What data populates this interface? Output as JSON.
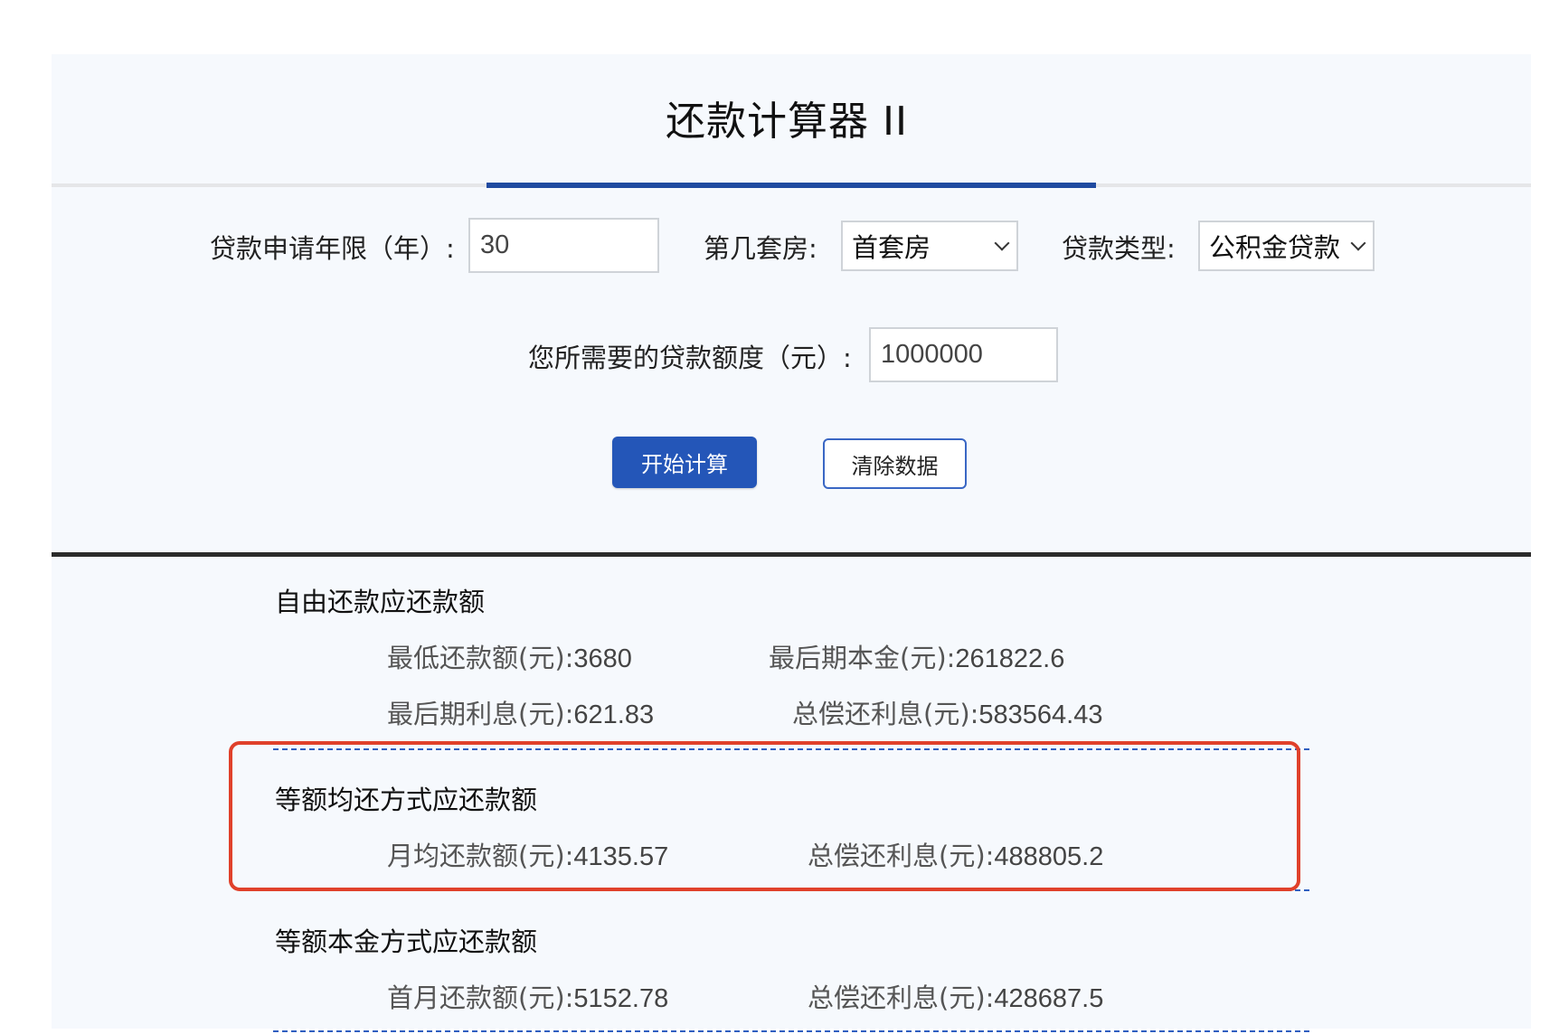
{
  "header": {
    "title": "还款计算器 II"
  },
  "form": {
    "years_label": "贷款申请年限（年）:",
    "years_value": "30",
    "house_label": "第几套房:",
    "house_value": "首套房",
    "type_label": "贷款类型:",
    "type_value": "公积金贷款",
    "amount_label": "您所需要的贷款额度（元）:",
    "amount_value": "1000000",
    "calc_button": "开始计算",
    "clear_button": "清除数据"
  },
  "results": {
    "free": {
      "title": "自由还款应还款额",
      "min_label": "最低还款额(元):",
      "min_value": "3680",
      "last_principal_label": "最后期本金(元):",
      "last_principal_value": "261822.6",
      "last_interest_label": "最后期利息(元):",
      "last_interest_value": "621.83",
      "total_interest_label": "总偿还利息(元):",
      "total_interest_value": "583564.43"
    },
    "equal_installment": {
      "title": "等额均还方式应还款额",
      "monthly_label": "月均还款额(元):",
      "monthly_value": "4135.57",
      "total_interest_label": "总偿还利息(元):",
      "total_interest_value": "488805.2"
    },
    "equal_principal": {
      "title": "等额本金方式应还款额",
      "first_month_label": "首月还款额(元):",
      "first_month_value": "5152.78",
      "total_interest_label": "总偿还利息(元):",
      "total_interest_value": "428687.5"
    }
  },
  "colors": {
    "accent": "#1f4aa0",
    "button_primary": "#2456b8",
    "highlight": "#e0412b",
    "panel_bg": "#f6f9fd"
  }
}
